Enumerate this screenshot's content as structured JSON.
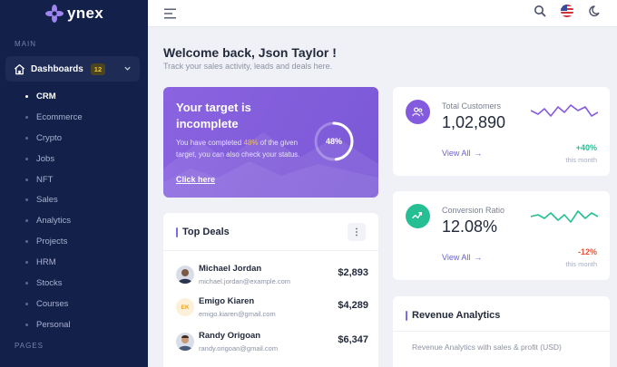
{
  "brand": {
    "name": "ynex"
  },
  "sidebar": {
    "main_label": "MAIN",
    "dashboards": {
      "label": "Dashboards",
      "badge": "12"
    },
    "items": [
      "CRM",
      "Ecommerce",
      "Crypto",
      "Jobs",
      "NFT",
      "Sales",
      "Analytics",
      "Projects",
      "HRM",
      "Stocks",
      "Courses",
      "Personal"
    ],
    "active_item": "CRM",
    "pages_label": "PAGES"
  },
  "header": {
    "icons": [
      "menu-icon",
      "search-icon",
      "us-flag-icon",
      "moon-icon"
    ]
  },
  "welcome": {
    "title": "Welcome back, Json Taylor !",
    "subtitle": "Track your sales activity, leads and deals here."
  },
  "target": {
    "title": "Your target is incomplete",
    "desc_before": "You have completed ",
    "desc_highlight": "48%",
    "desc_after": " of the given target, you can also check your status.",
    "link": "Click here",
    "percent_label": "48%",
    "percent_value": 48,
    "highlight_color": "#f4c23c"
  },
  "stats": [
    {
      "label": "Total Customers",
      "value": "1,02,890",
      "link": "View All",
      "change": "+40%",
      "period": "this month",
      "icon": "users-icon",
      "icon_color": "#845adf",
      "spark_color": "#845adf",
      "change_color": "#26bf94"
    },
    {
      "label": "Conversion Ratio",
      "value": "12.08%",
      "link": "View All",
      "change": "-12%",
      "period": "this month",
      "icon": "wave-icon",
      "icon_color": "#26bf94",
      "spark_color": "#26bf94",
      "change_color": "#e6533c"
    }
  ],
  "deals": {
    "title": "Top Deals",
    "rows": [
      {
        "name": "Michael Jordan",
        "email": "michael.jordan@example.com",
        "amount": "$2,893",
        "avatar": "photo"
      },
      {
        "name": "Emigo Kiaren",
        "email": "emigo.kiaren@gmail.com",
        "amount": "$4,289",
        "avatar": "EK"
      },
      {
        "name": "Randy Origoan",
        "email": "randy.origoan@gmail.com",
        "amount": "$6,347",
        "avatar": "photo"
      }
    ]
  },
  "revenue": {
    "title": "Revenue Analytics",
    "subtitle": "Revenue Analytics with sales & profit (USD)"
  }
}
